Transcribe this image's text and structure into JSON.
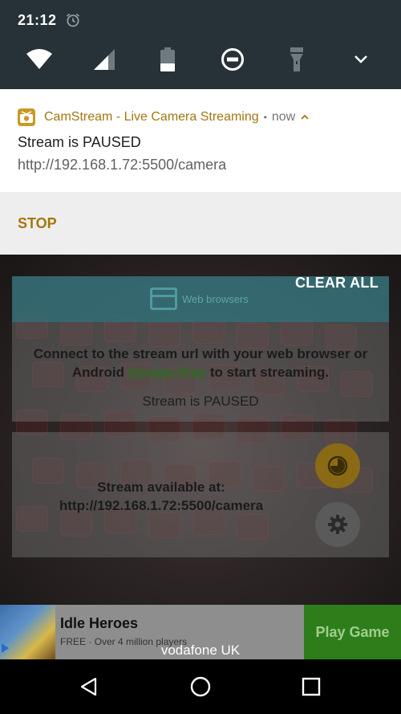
{
  "status_bar": {
    "time": "21:12"
  },
  "quick_settings": {
    "tiles": [
      "wifi-icon",
      "signal-icon",
      "battery-icon",
      "do-not-disturb-icon",
      "flashlight-icon",
      "expand-icon"
    ]
  },
  "notification": {
    "app_name": "CamStream - Live Camera Streaming",
    "separator": "•",
    "when": "now",
    "title": "Stream is PAUSED",
    "text": "http://192.168.1.72:5500/camera",
    "action_stop": "STOP",
    "accent_color": "#a4770f"
  },
  "shade": {
    "clear_all": "CLEAR ALL"
  },
  "app": {
    "card1": {
      "header_label": "Web browsers",
      "instructions_part1": "Connect to the stream url with your web browser or Android ",
      "instructions_link": "Stream Play",
      "instructions_part2": " to start streaming.",
      "status": "Stream is PAUSED"
    },
    "card2": {
      "label": "Stream available at:",
      "url": "http://192.168.1.72:5500/camera"
    }
  },
  "ad": {
    "title": "Idle Heroes",
    "subtitle": "FREE · Over 4 million players",
    "cta": "Play Game"
  },
  "carrier": "vodafone UK"
}
